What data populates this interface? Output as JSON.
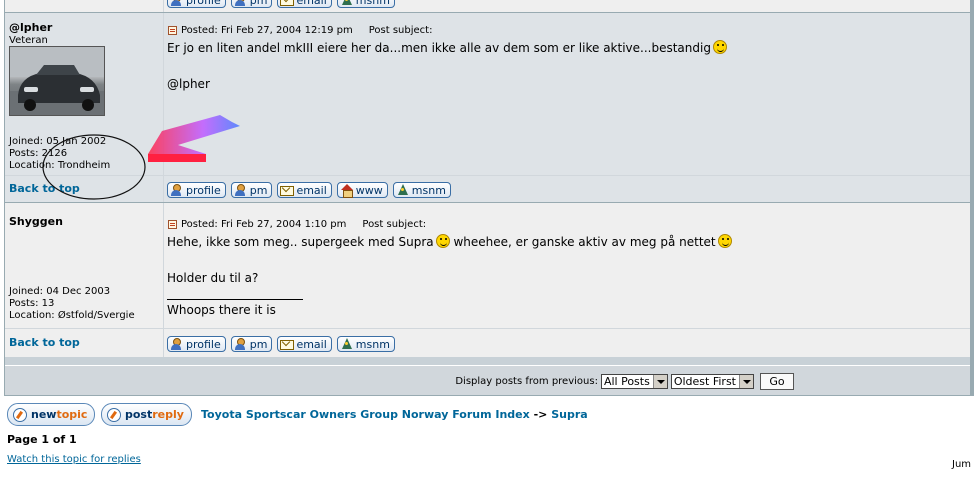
{
  "top_row": {
    "buttons": [
      "profile",
      "pm",
      "email",
      "msnm"
    ]
  },
  "posts": [
    {
      "username": "@lpher",
      "rank": "Veteran",
      "joined": "Joined: 05 Jan 2002",
      "posts": "Posts: 2126",
      "location": "Location: Trondheim",
      "posted": "Posted: Fri Feb 27, 2004 12:19 pm",
      "subject": "Post subject:",
      "body": [
        "Er jo en liten andel mkIII eiere her da...men ikke alle av dem som er like aktive...bestandig",
        "",
        "@lpher"
      ],
      "back_to_top": "Back to top",
      "buttons": [
        "profile",
        "pm",
        "email",
        "www",
        "msnm"
      ]
    },
    {
      "username": "Shyggen",
      "joined": "Joined: 04 Dec 2003",
      "posts": "Posts: 13",
      "location": "Location: Østfold/Svergie",
      "posted": "Posted: Fri Feb 27, 2004 1:10 pm",
      "subject": "Post subject:",
      "body_line1_a": "Hehe, ikke som meg.. supergeek med Supra",
      "body_line1_b": " wheehee, er ganske aktiv av meg på nettet",
      "body_line2": "Holder du til a?",
      "signature": "Whoops there it is",
      "back_to_top": "Back to top",
      "buttons": [
        "profile",
        "pm",
        "email",
        "msnm"
      ]
    }
  ],
  "footer": {
    "display_label": "Display posts from previous:",
    "range_select": "All Posts",
    "order_select": "Oldest First",
    "go_label": "Go"
  },
  "actions": {
    "new_topic": [
      "new",
      "topic"
    ],
    "post_reply": [
      "post",
      "reply"
    ]
  },
  "breadcrumb": {
    "index": "Toyota Sportscar Owners Group Norway Forum Index",
    "sep": " -> ",
    "forum": "Supra"
  },
  "pagination": "Page 1 of 1",
  "watch_link": "Watch this topic for replies",
  "jump_label": "Jum",
  "colors": {
    "link": "#006699",
    "row_light": "#efefef",
    "row_dark": "#dee3e7",
    "border": "#98aab1",
    "annotation_arrow": "#ff3050"
  }
}
